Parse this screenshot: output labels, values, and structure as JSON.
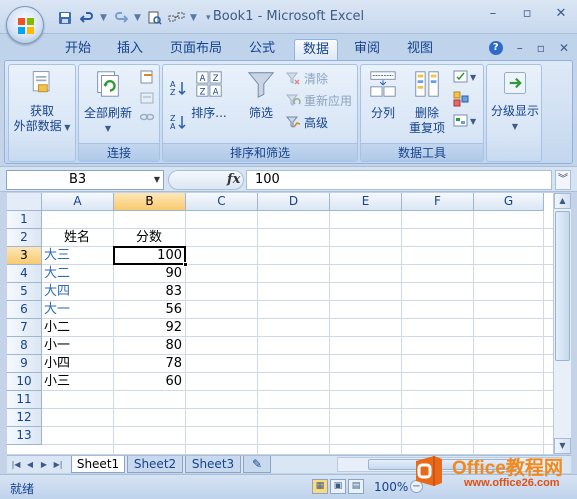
{
  "window": {
    "title": "Book1 - Microsoft Excel"
  },
  "tabs": [
    "开始",
    "插入",
    "页面布局",
    "公式",
    "数据",
    "审阅",
    "视图"
  ],
  "active_tab": "数据",
  "ribbon": {
    "get_external": {
      "line1": "获取",
      "line2": "外部数据"
    },
    "connections": {
      "label": "连接",
      "refresh_all": "全部刷新"
    },
    "sort_filter": {
      "label": "排序和筛选",
      "sort": "排序...",
      "filter": "筛选",
      "clear": "清除",
      "reapply": "重新应用",
      "advanced": "高级"
    },
    "data_tools": {
      "label": "数据工具",
      "text_to_columns": "分列",
      "remove_dup_line1": "删除",
      "remove_dup_line2": "重复项"
    },
    "outline": {
      "label": "分级显示"
    }
  },
  "formula_bar": {
    "name_box": "B3",
    "fx": "fx",
    "value": "100"
  },
  "columns": [
    "A",
    "B",
    "C",
    "D",
    "E",
    "F",
    "G"
  ],
  "rows": [
    "1",
    "2",
    "3",
    "4",
    "5",
    "6",
    "7",
    "8",
    "9",
    "10",
    "11",
    "12",
    "13"
  ],
  "headers": {
    "name": "姓名",
    "score": "分数"
  },
  "data_rows": [
    {
      "name": "大三",
      "score": "100"
    },
    {
      "name": "大二",
      "score": "90"
    },
    {
      "name": "大四",
      "score": "83"
    },
    {
      "name": "大一",
      "score": "56"
    },
    {
      "name": "小二",
      "score": "92"
    },
    {
      "name": "小一",
      "score": "80"
    },
    {
      "name": "小四",
      "score": "78"
    },
    {
      "name": "小三",
      "score": "60"
    }
  ],
  "sheets": [
    "Sheet1",
    "Sheet2",
    "Sheet3"
  ],
  "active_sheet": "Sheet1",
  "status": {
    "text": "就绪",
    "zoom": "100%"
  },
  "watermark": {
    "title": "Office教程网",
    "url": "www.office26.com"
  },
  "colors": {
    "accent": "#15428b",
    "selection": "#f9c96f",
    "link_text": "#2f6bb7"
  }
}
